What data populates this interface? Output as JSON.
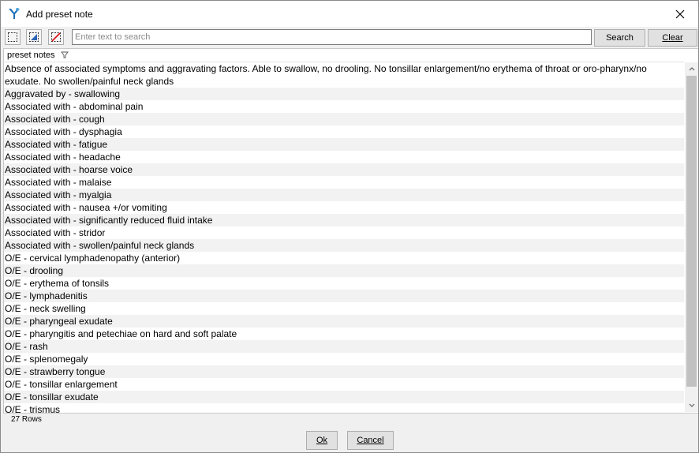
{
  "window": {
    "title": "Add preset note"
  },
  "toolbar": {
    "search_placeholder": "Enter text to search",
    "search_value": "",
    "search_label": "Search",
    "clear_label": "Clear"
  },
  "grid": {
    "column_header": "preset notes",
    "rows": [
      "Absence of associated symptoms and aggravating factors. Able to swallow, no drooling. No tonsillar enlargement/no erythema of throat or oro-pharynx/no exudate. No swollen/painful neck glands",
      "Aggravated by - swallowing",
      "Associated with - abdominal pain",
      "Associated with - cough",
      "Associated with - dysphagia",
      "Associated with - fatigue",
      "Associated with - headache",
      "Associated with - hoarse voice",
      "Associated with - malaise",
      "Associated with - myalgia",
      "Associated with - nausea +/or vomiting",
      "Associated with - significantly reduced fluid intake",
      "Associated with - stridor",
      "Associated with - swollen/painful neck glands",
      "O/E - cervical lymphadenopathy (anterior)",
      "O/E - drooling",
      "O/E - erythema of tonsils",
      "O/E - lymphadenitis",
      "O/E - neck swelling",
      "O/E - pharyngeal exudate",
      "O/E - pharyngitis and petechiae on hard and soft palate",
      "O/E - rash",
      "O/E - splenomegaly",
      "O/E - strawberry tongue",
      "O/E - tonsillar enlargement",
      "O/E - tonsillar exudate",
      "O/E - trismus"
    ]
  },
  "status": {
    "row_count": "27 Rows"
  },
  "footer": {
    "ok_label": "Ok",
    "cancel_label": "Cancel"
  }
}
